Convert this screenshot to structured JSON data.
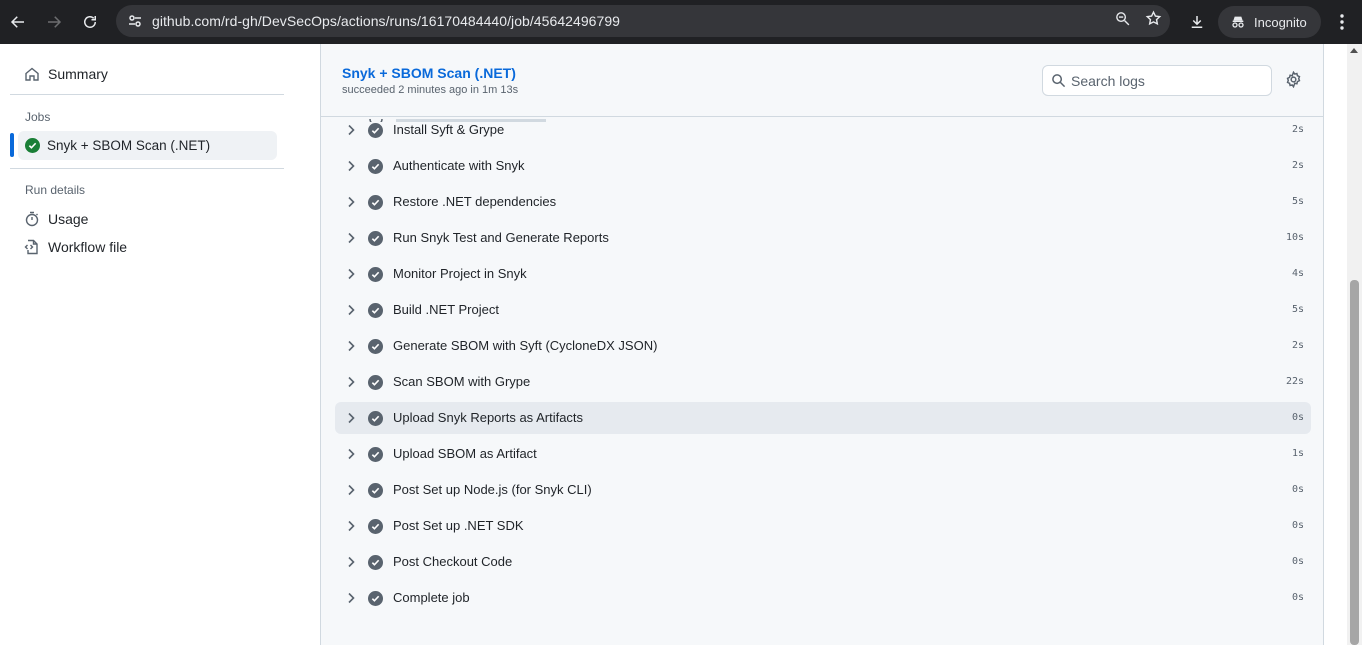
{
  "browser": {
    "url": "github.com/rd-gh/DevSecOps/actions/runs/16170484440/job/45642496799",
    "profile_label": "Incognito"
  },
  "sidebar": {
    "summary_label": "Summary",
    "jobs_heading": "Jobs",
    "active_job_label": "Snyk + SBOM Scan (.NET)",
    "run_details_heading": "Run details",
    "usage_label": "Usage",
    "workflow_file_label": "Workflow file"
  },
  "job": {
    "title": "Snyk + SBOM Scan (.NET)",
    "meta": "succeeded 2 minutes ago in 1m 13s",
    "search_placeholder": "Search logs"
  },
  "steps": [
    {
      "name": "Install Syft & Grype",
      "duration": "2s"
    },
    {
      "name": "Authenticate with Snyk",
      "duration": "2s"
    },
    {
      "name": "Restore .NET dependencies",
      "duration": "5s"
    },
    {
      "name": "Run Snyk Test and Generate Reports",
      "duration": "10s"
    },
    {
      "name": "Monitor Project in Snyk",
      "duration": "4s"
    },
    {
      "name": "Build .NET Project",
      "duration": "5s"
    },
    {
      "name": "Generate SBOM with Syft (CycloneDX JSON)",
      "duration": "2s"
    },
    {
      "name": "Scan SBOM with Grype",
      "duration": "22s"
    },
    {
      "name": "Upload Snyk Reports as Artifacts",
      "duration": "0s"
    },
    {
      "name": "Upload SBOM as Artifact",
      "duration": "1s"
    },
    {
      "name": "Post Set up Node.js (for Snyk CLI)",
      "duration": "0s"
    },
    {
      "name": "Post Set up .NET SDK",
      "duration": "0s"
    },
    {
      "name": "Post Checkout Code",
      "duration": "0s"
    },
    {
      "name": "Complete job",
      "duration": "0s"
    }
  ],
  "highlighted_step_index": 8,
  "colors": {
    "accent": "#0969da",
    "success": "#1a7f37",
    "chrome_bg": "#202124"
  }
}
